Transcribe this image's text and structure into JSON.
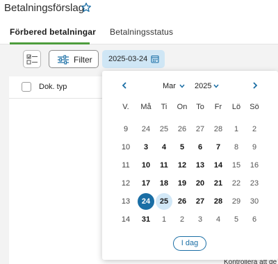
{
  "header": {
    "title": "Betalningsförslag",
    "star_icon": "star-icon"
  },
  "tabs": [
    {
      "label": "Förbered betalningar",
      "active": true
    },
    {
      "label": "Betalningsstatus",
      "active": false
    }
  ],
  "toolbar": {
    "filter_label": "Filter",
    "date_value": "2025-03-24"
  },
  "table": {
    "col_doktyp": "Dok. typ"
  },
  "bottom_text": "Kontrollera att de",
  "calendar": {
    "month": "Mar",
    "year": "2025",
    "headers": [
      "V.",
      "Må",
      "Ti",
      "On",
      "To",
      "Fr",
      "Lö",
      "Sö"
    ],
    "weeks": [
      {
        "week": "9",
        "days": [
          {
            "d": "24",
            "t": "other"
          },
          {
            "d": "25",
            "t": "other"
          },
          {
            "d": "26",
            "t": "other"
          },
          {
            "d": "27",
            "t": "other"
          },
          {
            "d": "28",
            "t": "other"
          },
          {
            "d": "1",
            "t": "wkend"
          },
          {
            "d": "2",
            "t": "wkend"
          }
        ]
      },
      {
        "week": "10",
        "days": [
          {
            "d": "3",
            "t": "cur"
          },
          {
            "d": "4",
            "t": "cur"
          },
          {
            "d": "5",
            "t": "cur"
          },
          {
            "d": "6",
            "t": "cur"
          },
          {
            "d": "7",
            "t": "cur"
          },
          {
            "d": "8",
            "t": "wkend"
          },
          {
            "d": "9",
            "t": "wkend"
          }
        ]
      },
      {
        "week": "11",
        "days": [
          {
            "d": "10",
            "t": "cur"
          },
          {
            "d": "11",
            "t": "cur"
          },
          {
            "d": "12",
            "t": "cur"
          },
          {
            "d": "13",
            "t": "cur"
          },
          {
            "d": "14",
            "t": "cur"
          },
          {
            "d": "15",
            "t": "wkend"
          },
          {
            "d": "16",
            "t": "wkend"
          }
        ]
      },
      {
        "week": "12",
        "days": [
          {
            "d": "17",
            "t": "cur"
          },
          {
            "d": "18",
            "t": "cur"
          },
          {
            "d": "19",
            "t": "cur"
          },
          {
            "d": "20",
            "t": "cur"
          },
          {
            "d": "21",
            "t": "cur"
          },
          {
            "d": "22",
            "t": "wkend"
          },
          {
            "d": "23",
            "t": "wkend"
          }
        ]
      },
      {
        "week": "13",
        "days": [
          {
            "d": "24",
            "t": "sel"
          },
          {
            "d": "25",
            "t": "rng"
          },
          {
            "d": "26",
            "t": "cur"
          },
          {
            "d": "27",
            "t": "cur"
          },
          {
            "d": "28",
            "t": "cur"
          },
          {
            "d": "29",
            "t": "wkend"
          },
          {
            "d": "30",
            "t": "wkend"
          }
        ]
      },
      {
        "week": "14",
        "days": [
          {
            "d": "31",
            "t": "cur"
          },
          {
            "d": "1",
            "t": "other"
          },
          {
            "d": "2",
            "t": "other"
          },
          {
            "d": "3",
            "t": "other"
          },
          {
            "d": "4",
            "t": "other"
          },
          {
            "d": "5",
            "t": "other"
          },
          {
            "d": "6",
            "t": "other"
          }
        ]
      }
    ],
    "today_label": "I dag"
  },
  "colors": {
    "accent": "#1a6ea5",
    "tab_underline": "#4e9d3d",
    "chip_bg": "#cfe6f5",
    "range_bg": "#d2e8f7"
  }
}
